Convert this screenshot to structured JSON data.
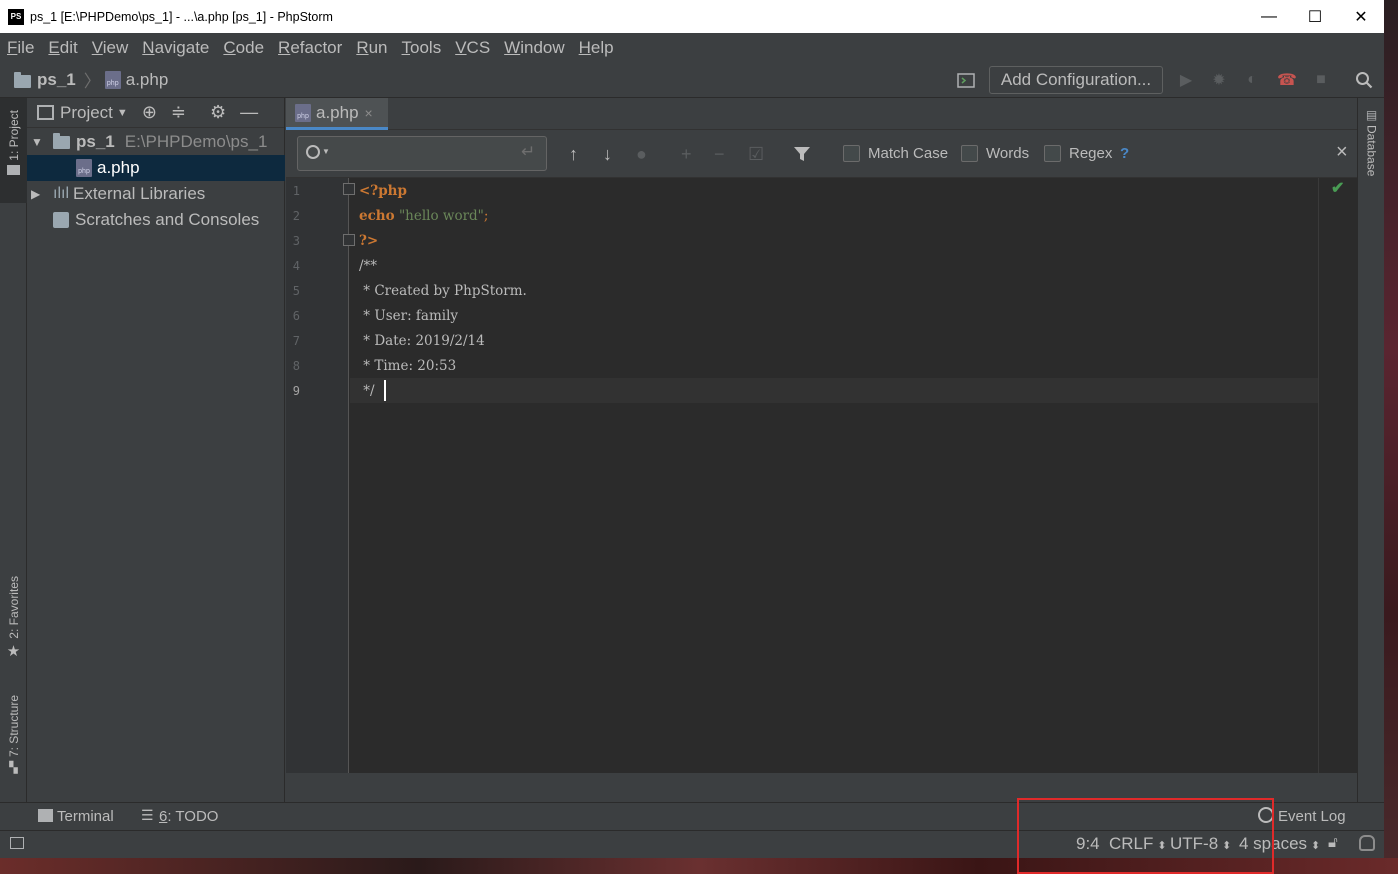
{
  "window": {
    "app_icon": "PS",
    "title": "ps_1 [E:\\PHPDemo\\ps_1] - ...\\a.php [ps_1] - PhpStorm",
    "minimize": "—",
    "maximize": "☐",
    "close": "✕"
  },
  "menu": {
    "items": [
      {
        "first": "F",
        "rest": "ile"
      },
      {
        "first": "E",
        "rest": "dit"
      },
      {
        "first": "V",
        "rest": "iew"
      },
      {
        "first": "N",
        "rest": "avigate"
      },
      {
        "first": "C",
        "rest": "ode"
      },
      {
        "first": "R",
        "rest": "efactor"
      },
      {
        "first": "R",
        "rest": "un"
      },
      {
        "first": "T",
        "rest": "ools"
      },
      {
        "first": "V",
        "rest": "CS"
      },
      {
        "first": "W",
        "rest": "indow"
      },
      {
        "first": "H",
        "rest": "elp"
      }
    ]
  },
  "nav": {
    "project": "ps_1",
    "file": "a.php",
    "add_configuration": "Add Configuration..."
  },
  "left_stripe": {
    "project_tab": "1: Project",
    "favorites_tab": "2: Favorites",
    "structure_tab": "7: Structure"
  },
  "project_panel": {
    "header": "Project",
    "root_name": "ps_1",
    "root_path": "E:\\PHPDemo\\ps_1",
    "file": "a.php",
    "external_libraries": "External Libraries",
    "scratches": "Scratches and Consoles"
  },
  "editor_tab": {
    "label": "a.php",
    "close": "×"
  },
  "search": {
    "match_case": "Match Case",
    "words": "Words",
    "regex": "Regex",
    "help": "?",
    "close": "×"
  },
  "code": {
    "lines": [
      {
        "n": "1",
        "text": "<?php"
      },
      {
        "n": "2",
        "kw": "echo",
        "str": "\"hello word\"",
        "punct": ";"
      },
      {
        "n": "3",
        "text": "?>"
      },
      {
        "n": "4",
        "text": "/**"
      },
      {
        "n": "5",
        "text": " * Created by PhpStorm."
      },
      {
        "n": "6",
        "text": " * User: family"
      },
      {
        "n": "7",
        "text": " * Date: 2019/2/14"
      },
      {
        "n": "8",
        "text": " * Time: 20:53"
      },
      {
        "n": "9",
        "text": " */"
      }
    ]
  },
  "right_stripe": {
    "database_tab": "Database"
  },
  "tool_windows": {
    "terminal": "Terminal",
    "todo_num": "6",
    "todo_label": ": TODO",
    "event_log": "Event Log"
  },
  "status": {
    "position": "9:4",
    "line_separator": "CRLF",
    "encoding": "UTF-8",
    "indent": "4 spaces"
  },
  "colors": {
    "keyword": "#cc7832",
    "string": "#6a8759",
    "comment": "#bbbbbb",
    "selection": "#0d293e",
    "accent": "#4a88c7",
    "annotation_box": "#e02a2a"
  }
}
